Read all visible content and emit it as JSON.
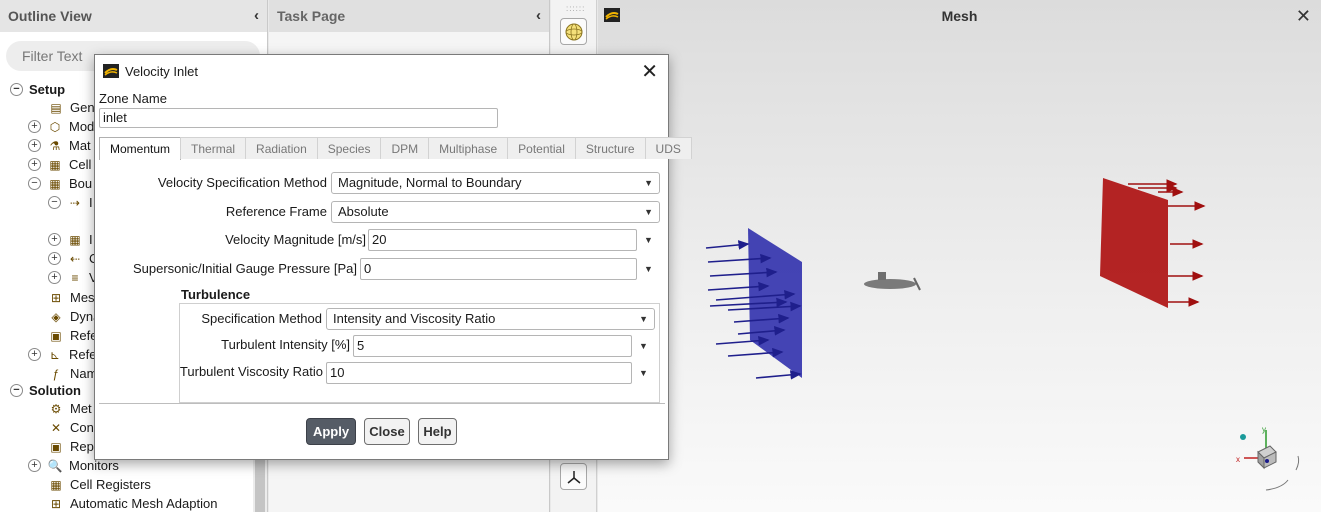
{
  "outline": {
    "title": "Outline View",
    "filter_placeholder": "Filter Text",
    "items": [
      {
        "label": "Setup",
        "expander": "−",
        "bold": true
      },
      {
        "label": "Gene",
        "icon": "general-icon"
      },
      {
        "label": "Mod",
        "expander": "+",
        "icon": "models-icon"
      },
      {
        "label": "Mat",
        "expander": "+",
        "icon": "materials-icon"
      },
      {
        "label": "Cell",
        "expander": "+",
        "icon": "cell-zones-icon"
      },
      {
        "label": "Bou",
        "expander": "−",
        "icon": "boundary-icon"
      },
      {
        "label": "I",
        "expander": "−",
        "icon": "inlet-icon"
      },
      {
        "label": "I",
        "expander": "+",
        "icon": "interior-icon"
      },
      {
        "label": "C",
        "expander": "+",
        "icon": "outlet-icon"
      },
      {
        "label": "V",
        "expander": "+",
        "icon": "wall-icon"
      },
      {
        "label": "Mes",
        "icon": "mesh-interfaces-icon"
      },
      {
        "label": "Dyna",
        "icon": "dynamic-mesh-icon"
      },
      {
        "label": "Refe",
        "icon": "reference-values-icon"
      },
      {
        "label": "Refe",
        "expander": "+",
        "icon": "reference-frames-icon"
      },
      {
        "label": "Nam",
        "icon": "named-expressions-icon"
      },
      {
        "label": "Solution",
        "expander": "−",
        "bold": true
      },
      {
        "label": "Met",
        "icon": "methods-icon"
      },
      {
        "label": "Con",
        "icon": "controls-icon"
      },
      {
        "label": "Rep",
        "icon": "report-definitions-icon"
      },
      {
        "label": "Monitors",
        "expander": "+",
        "icon": "monitors-icon"
      },
      {
        "label": "Cell Registers",
        "icon": "cell-registers-icon"
      },
      {
        "label": "Automatic Mesh Adaption",
        "icon": "mesh-adaption-icon"
      }
    ]
  },
  "task_page": {
    "title": "Task Page"
  },
  "mesh": {
    "title": "Mesh"
  },
  "dialog": {
    "title": "Velocity Inlet",
    "zone_name_label": "Zone Name",
    "zone_name_value": "inlet",
    "tabs": [
      "Momentum",
      "Thermal",
      "Radiation",
      "Species",
      "DPM",
      "Multiphase",
      "Potential",
      "Structure",
      "UDS"
    ],
    "active_tab": "Momentum",
    "velocity_spec_label": "Velocity Specification Method",
    "velocity_spec_value": "Magnitude, Normal to Boundary",
    "reference_frame_label": "Reference Frame",
    "reference_frame_value": "Absolute",
    "velocity_magnitude_label": "Velocity Magnitude [m/s]",
    "velocity_magnitude_value": "20",
    "gauge_pressure_label": "Supersonic/Initial Gauge Pressure [Pa]",
    "gauge_pressure_value": "0",
    "turbulence_heading": "Turbulence",
    "spec_method_label": "Specification Method",
    "spec_method_value": "Intensity and Viscosity Ratio",
    "turb_intensity_label": "Turbulent Intensity [%]",
    "turb_intensity_value": "5",
    "turb_visc_label": "Turbulent Viscosity Ratio",
    "turb_visc_value": "10",
    "buttons": {
      "apply": "Apply",
      "close": "Close",
      "help": "Help"
    }
  },
  "colors": {
    "inlet": "#3a3ab0",
    "outlet": "#b01818",
    "apply_bg": "#555c66"
  }
}
